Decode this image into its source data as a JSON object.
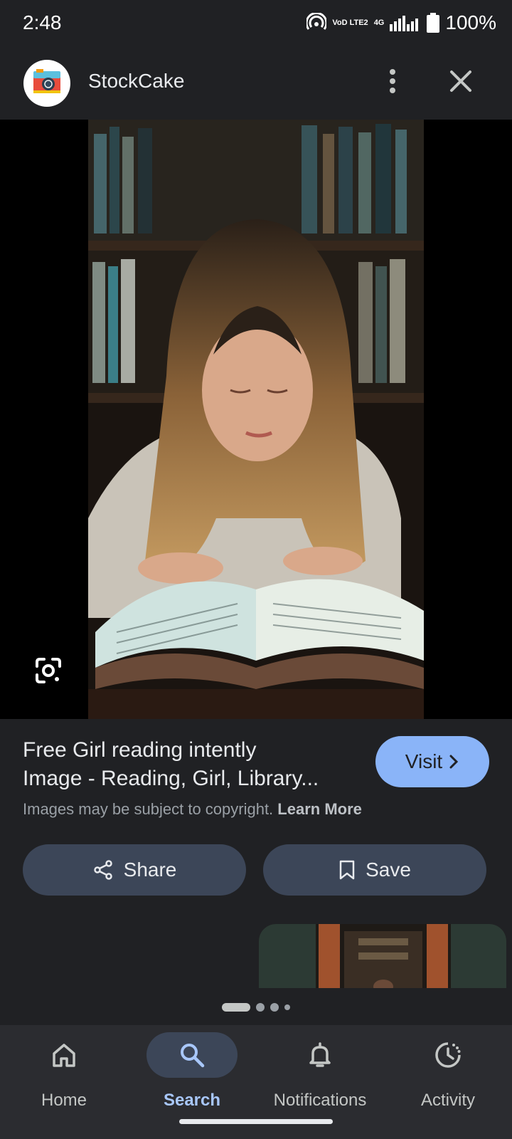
{
  "status_bar": {
    "time": "2:48",
    "battery": "100%",
    "network_top": "VoD LTE2",
    "network_small": "4G"
  },
  "header": {
    "site_name": "StockCake",
    "logo_icon": "camera-logo-icon",
    "more_icon": "more-vert-icon",
    "close_icon": "close-icon"
  },
  "viewer": {
    "image_subject": "girl-reading-book-in-library",
    "lens_icon": "google-lens-icon"
  },
  "result": {
    "title_line1": "Free Girl reading intently",
    "title_line2": "Image - Reading, Girl, Library...",
    "visit_label": "Visit",
    "copyright_text": "Images may be subject to copyright.",
    "learn_more": "Learn More",
    "share_label": "Share",
    "save_label": "Save"
  },
  "pager": {
    "count": 4,
    "active_index": 0
  },
  "bottom_nav": [
    {
      "label": "Home",
      "icon": "home-icon",
      "active": false
    },
    {
      "label": "Search",
      "icon": "search-icon",
      "active": true
    },
    {
      "label": "Notifications",
      "icon": "bell-icon",
      "active": false
    },
    {
      "label": "Activity",
      "icon": "activity-icon",
      "active": false
    }
  ],
  "colors": {
    "background": "#202124",
    "accent": "#8ab4f8",
    "button": "#3c4658",
    "nav_bg": "#2b2c30"
  }
}
